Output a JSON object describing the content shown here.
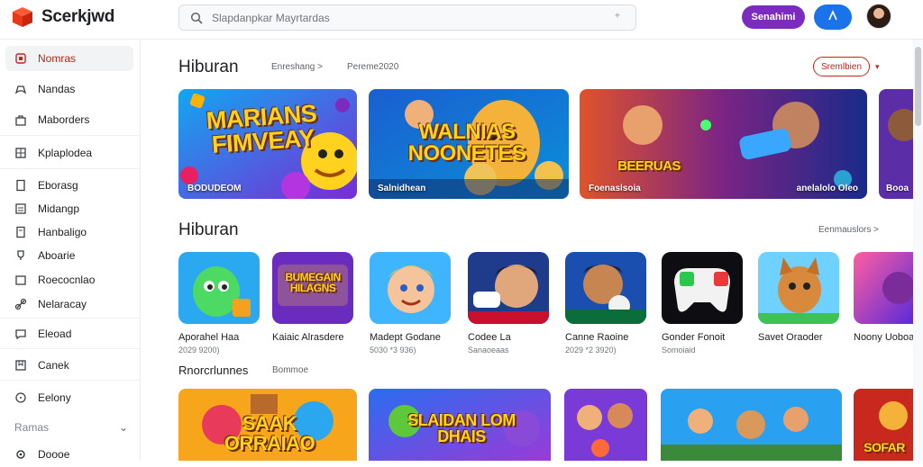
{
  "app": {
    "name": "Scerkjwd"
  },
  "search": {
    "placeholder": "Slapdanpkar Mayrtardas"
  },
  "header": {
    "primary_button": "Senahimi"
  },
  "sidebar": {
    "items": [
      {
        "label": "Nomras"
      },
      {
        "label": "Nandas"
      },
      {
        "label": "Maborders"
      },
      {
        "label": "Kplaplodea"
      },
      {
        "label": "Eborasg"
      },
      {
        "label": "Midangp"
      },
      {
        "label": "Hanbaligo"
      },
      {
        "label": "Aboarie"
      },
      {
        "label": "Roecocnlao"
      },
      {
        "label": "Nelaracay"
      },
      {
        "label": "Eleoad"
      },
      {
        "label": "Canek"
      },
      {
        "label": "Eelony"
      }
    ],
    "section_label": "Ramas",
    "last_item": "Doooe"
  },
  "featured": {
    "title": "Hiburan",
    "link1": "Enreshang >",
    "link2": "Pereme2020",
    "filter_button": "Sremlbien",
    "cards": [
      {
        "headline": "MARIANS FIMVEAY",
        "label": "BODUDEOM"
      },
      {
        "headline": "WALNIAS NOONETES",
        "label": "Salnidhean"
      },
      {
        "headline": "BEERUAS",
        "label": "Foenaslsoia",
        "label2": "anelalolo Oleo"
      },
      {
        "headline": "",
        "label": "Booa"
      }
    ]
  },
  "apps_section": {
    "title": "Hiburan",
    "link": "Eenmauslors >",
    "apps": [
      {
        "name": "Aporahel Haa",
        "sub": "2029 9200)"
      },
      {
        "name": "Kaiaic Alrasdere",
        "sub": ""
      },
      {
        "name": "Madept Godane",
        "sub": "5030 *3 936)"
      },
      {
        "name": "Codee La",
        "sub": "Sanaoeaas"
      },
      {
        "name": "Canne Raoine",
        "sub": "2029 *2 3920)"
      },
      {
        "name": "Gonder Fonoit",
        "sub": "Somoiaid"
      },
      {
        "name": "Savet Oraoder",
        "sub": ""
      },
      {
        "name": "Noony Uoboa",
        "sub": ""
      }
    ],
    "tile_texts": {
      "app2": "BUMEGAIN HILAGNS"
    }
  },
  "third_section": {
    "title": "Rnorcrlunnes",
    "link": "Bommoe",
    "cards": [
      {
        "headline": "SAAK ORRAIAO"
      },
      {
        "headline": "SLAIDAN LOM DHAIS"
      },
      {
        "headline": ""
      },
      {
        "headline": ""
      },
      {
        "headline": "SOFAR"
      }
    ]
  }
}
